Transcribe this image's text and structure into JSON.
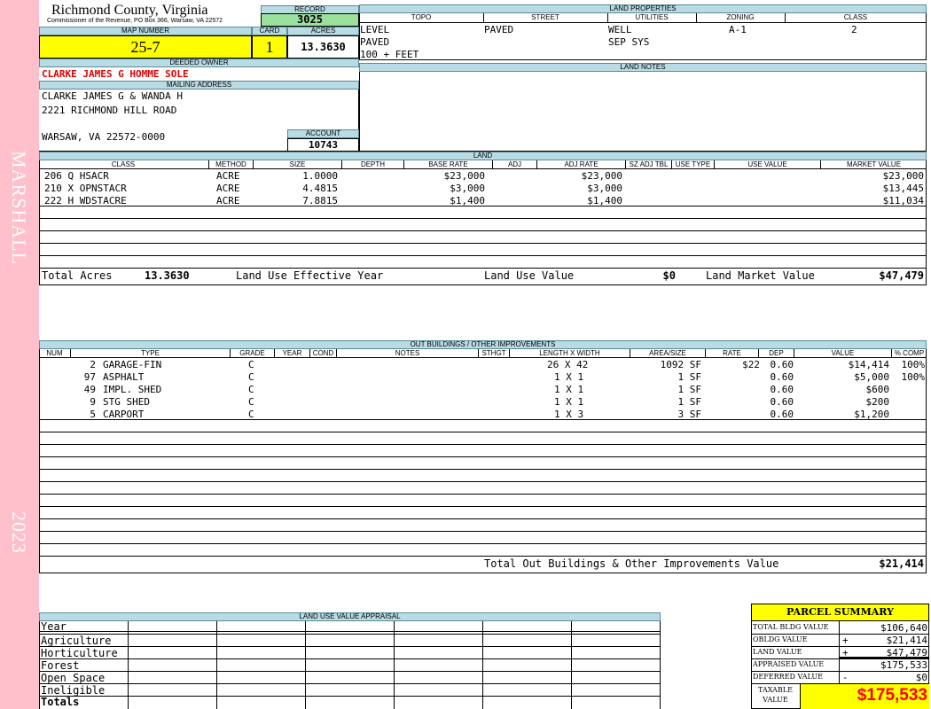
{
  "sidebar": {
    "district": "MARSHALL",
    "year": "2023",
    "color": "#ffc0cb"
  },
  "header": {
    "county": "Richmond County, Virginia",
    "address": "Commissioner of the Revenue, PO Box 366, Warsaw, VA 22572",
    "record_label": "RECORD",
    "record": "3025",
    "map_label": "MAP NUMBER",
    "map": "25-7",
    "card_label": "CARD",
    "card": "1",
    "acres_label": "ACRES",
    "acres": "13.3630"
  },
  "land_properties": {
    "title": "LAND PROPERTIES",
    "headers": [
      "TOPO",
      "STREET",
      "UTILITIES",
      "ZONING",
      "CLASS"
    ],
    "topo": [
      "LEVEL",
      "PAVED",
      "100 + FEET"
    ],
    "street": "PAVED",
    "utilities": [
      "WELL",
      "SEP SYS"
    ],
    "zoning": "A-1",
    "class": "2"
  },
  "owner": {
    "deeded_label": "DEEDED OWNER",
    "deeded": "CLARKE JAMES G HOMME SOLE",
    "mailing_label": "MAILING ADDRESS",
    "mail1": "CLARKE JAMES G & WANDA H",
    "mail2": "2221 RICHMOND HILL ROAD",
    "mail3": "WARSAW, VA 22572-0000",
    "account_label": "ACCOUNT",
    "account": "10743"
  },
  "land_notes": {
    "title": "LAND NOTES"
  },
  "land": {
    "title": "LAND",
    "headers": [
      "CLASS",
      "METHOD",
      "SIZE",
      "DEPTH",
      "BASE RATE",
      "ADJ",
      "ADJ RATE",
      "SZ ADJ TBL",
      "USE TYPE",
      "USE VALUE",
      "MARKET VALUE"
    ],
    "rows": [
      {
        "class": "206 Q HSACR",
        "method": "ACRE",
        "size": "1.0000",
        "base": "$23,000",
        "adjrate": "$23,000",
        "market": "$23,000"
      },
      {
        "class": "210 X OPNSTACR",
        "method": "ACRE",
        "size": "4.4815",
        "base": "$3,000",
        "adjrate": "$3,000",
        "market": "$13,445"
      },
      {
        "class": "222 H WDSTACRE",
        "method": "ACRE",
        "size": "7.8815",
        "base": "$1,400",
        "adjrate": "$1,400",
        "market": "$11,034"
      }
    ],
    "total_acres_label": "Total Acres",
    "total_acres": "13.3630",
    "eff_year_label": "Land Use Effective Year",
    "use_value_label": "Land Use Value",
    "use_value": "$0",
    "market_label": "Land Market Value",
    "market": "$47,479"
  },
  "outbuildings": {
    "title": "OUT BUILDINGS / OTHER IMPROVEMENTS",
    "headers": [
      "NUM",
      "TYPE",
      "GRADE",
      "YEAR",
      "COND",
      "NOTES",
      "STHGT",
      "LENGTH X WIDTH",
      "AREA/SIZE",
      "RATE",
      "DEP",
      "VALUE",
      "% COMP"
    ],
    "rows": [
      {
        "num": "2",
        "type": "GARAGE-FIN",
        "grade": "C",
        "lw": "26 X 42",
        "area": "1092 SF",
        "rate": "$22",
        "dep": "0.60",
        "value": "$14,414",
        "comp": "100%"
      },
      {
        "num": "97",
        "type": "ASPHALT",
        "grade": "C",
        "lw": "1 X 1",
        "area": "1 SF",
        "rate": "",
        "dep": "0.60",
        "value": "$5,000",
        "comp": "100%"
      },
      {
        "num": "49",
        "type": "IMPL. SHED",
        "grade": "C",
        "lw": "1 X 1",
        "area": "1 SF",
        "rate": "",
        "dep": "0.60",
        "value": "$600",
        "comp": ""
      },
      {
        "num": "9",
        "type": "STG SHED",
        "grade": "C",
        "lw": "1 X 1",
        "area": "1 SF",
        "rate": "",
        "dep": "0.60",
        "value": "$200",
        "comp": ""
      },
      {
        "num": "5",
        "type": "CARPORT",
        "grade": "C",
        "lw": "1 X 3",
        "area": "3 SF",
        "rate": "",
        "dep": "0.60",
        "value": "$1,200",
        "comp": ""
      }
    ],
    "total_label": "Total Out Buildings & Other Improvements Value",
    "total": "$21,414"
  },
  "land_use_appraisal": {
    "title": "LAND USE VALUE APPRAISAL",
    "rows": [
      "Year",
      "Agriculture",
      "Horticulture",
      "Forest",
      "Open Space",
      "Ineligible",
      "Totals"
    ]
  },
  "summary": {
    "title": "PARCEL SUMMARY",
    "rows": [
      {
        "label": "TOTAL BLDG VALUE",
        "op": "",
        "value": "$106,640"
      },
      {
        "label": "OBLDG VALUE",
        "op": "+",
        "value": "$21,414"
      },
      {
        "label": "LAND VALUE",
        "op": "+",
        "value": "$47,479"
      },
      {
        "label": "APPRAISED VALUE",
        "op": "",
        "value": "$175,533"
      },
      {
        "label": "DEFERRED VALUE",
        "op": "-",
        "value": "$0"
      }
    ],
    "taxable_label1": "TAXABLE",
    "taxable_label2": "VALUE",
    "taxable": "$175,533",
    "accent": "#ffff00",
    "red": "#ff0000"
  }
}
